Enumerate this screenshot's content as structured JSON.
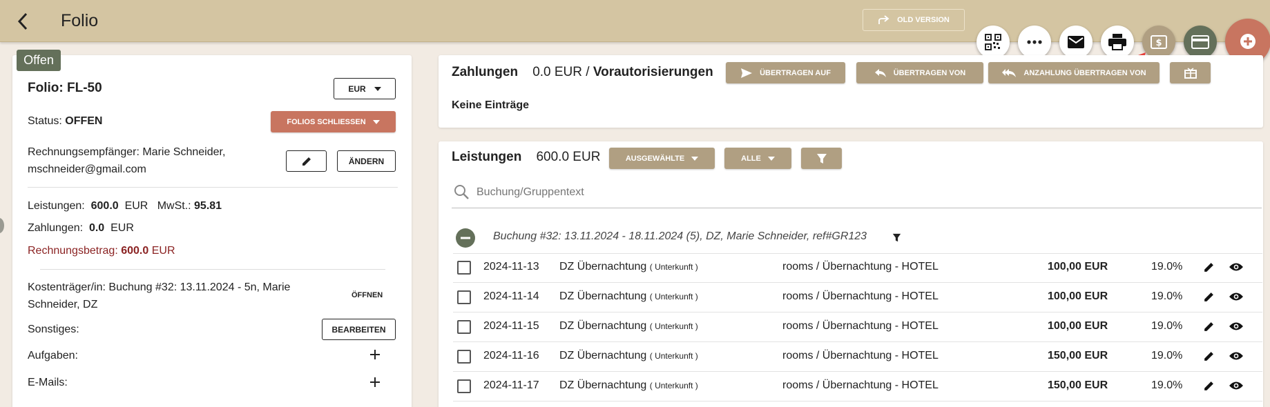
{
  "header": {
    "title": "Folio",
    "old_version_label": "OLD VERSION",
    "fab_icons": [
      "qr-code-icon",
      "more-icon",
      "mail-icon",
      "print-icon",
      "currency-icon",
      "credit-card-icon",
      "add-icon"
    ]
  },
  "folio": {
    "status_badge": "Offen",
    "title": "Folio: FL-50",
    "currency": "EUR",
    "status_label": "Status:",
    "status_value": "OFFEN",
    "close_folios_label": "FOLIOS SCHLIESSEN",
    "recipient_label": "Rechnungsempfänger:",
    "recipient_name": "Marie Schneider,",
    "recipient_email": "mschneider@gmail.com",
    "change_label": "ÄNDERN",
    "leistungen_label": "Leistungen:",
    "leistungen_value": "600.0",
    "leistungen_currency": "EUR",
    "mwst_label": "MwSt.:",
    "mwst_value": "95.81",
    "zahlungen_label": "Zahlungen:",
    "zahlungen_value": "0.0",
    "zahlungen_currency": "EUR",
    "rechnungsbetrag_label": "Rechnungsbetrag:",
    "rechnungsbetrag_value": "600.0",
    "rechnungsbetrag_currency": "EUR",
    "kostentraeger_label": "Kostenträger/in:",
    "kostentraeger_line1": "Buchung #32: 13.11.2024 - 5n, Marie",
    "kostentraeger_line2": "Schneider, DZ",
    "open_label": "ÖFFNEN",
    "sonstiges_label": "Sonstiges:",
    "edit_label": "BEARBEITEN",
    "aufgaben_label": "Aufgaben:",
    "emails_label": "E-Mails:"
  },
  "payments": {
    "title": "Zahlungen",
    "amount": "0.0 EUR /",
    "preauth_label": "Vorautorisierungen",
    "transfer_to": "ÜBERTRAGEN AUF",
    "transfer_from": "ÜBERTRAGEN VON",
    "deposit_transfer": "ANZAHLUNG ÜBERTRAGEN VON",
    "empty": "Keine Einträge"
  },
  "services": {
    "title": "Leistungen",
    "amount": "600.0 EUR",
    "selected_label": "AUSGEWÄHLTE",
    "all_label": "ALLE",
    "search_placeholder": "Buchung/Gruppentext",
    "group_label": "Buchung #32: 13.11.2024 - 18.11.2024 (5), DZ, Marie Schneider, ref#GR123",
    "rows": [
      {
        "date": "2024-11-13",
        "name": "DZ Übernachtung",
        "type": "( Unterkunft )",
        "account": "rooms / Übernachtung - HOTEL",
        "amount": "100,00 EUR",
        "vat": "19.0%"
      },
      {
        "date": "2024-11-14",
        "name": "DZ Übernachtung",
        "type": "( Unterkunft )",
        "account": "rooms / Übernachtung - HOTEL",
        "amount": "100,00 EUR",
        "vat": "19.0%"
      },
      {
        "date": "2024-11-15",
        "name": "DZ Übernachtung",
        "type": "( Unterkunft )",
        "account": "rooms / Übernachtung - HOTEL",
        "amount": "100,00 EUR",
        "vat": "19.0%"
      },
      {
        "date": "2024-11-16",
        "name": "DZ Übernachtung",
        "type": "( Unterkunft )",
        "account": "rooms / Übernachtung - HOTEL",
        "amount": "150,00 EUR",
        "vat": "19.0%"
      },
      {
        "date": "2024-11-17",
        "name": "DZ Übernachtung",
        "type": "( Unterkunft )",
        "account": "rooms / Übernachtung - HOTEL",
        "amount": "150,00 EUR",
        "vat": "19.0%"
      }
    ]
  },
  "colors": {
    "topbar": "#d4c5a2",
    "tan_button": "#b09f82",
    "danger_button": "#c87560",
    "badge": "#64705a",
    "invoice_red": "#8b2323",
    "annotation_arrow": "#e8403c"
  }
}
